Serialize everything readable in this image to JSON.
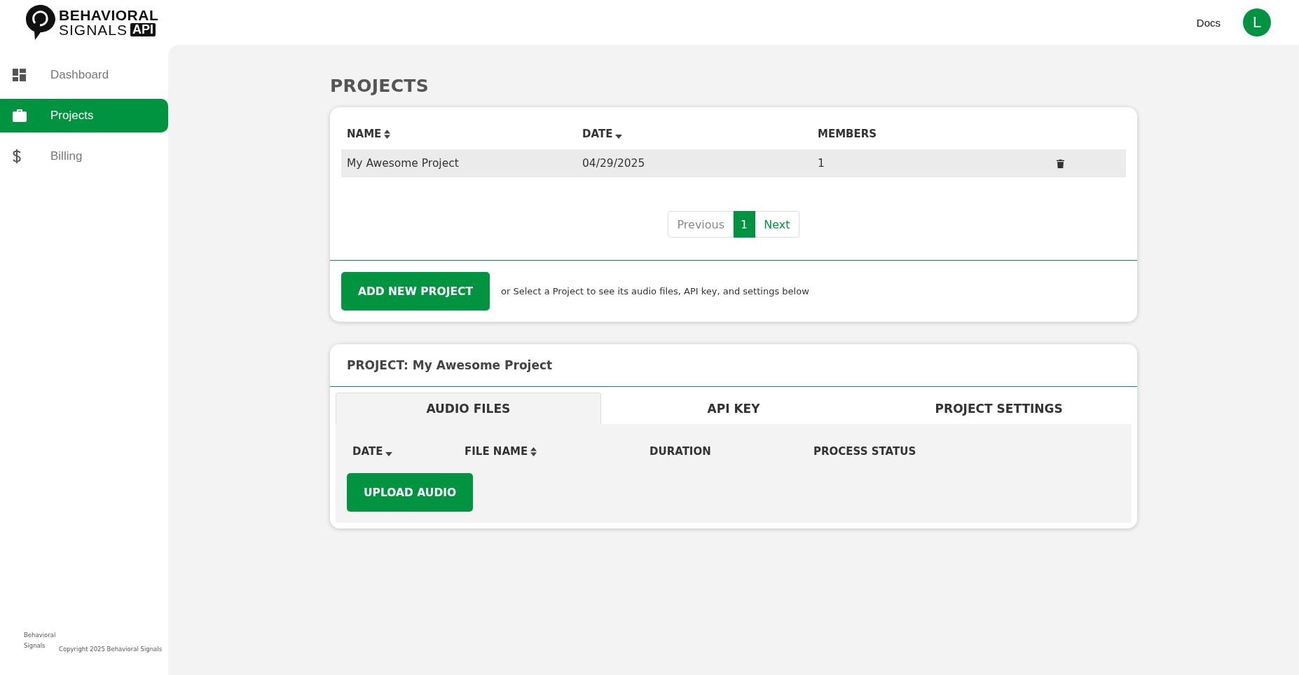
{
  "header": {
    "logo": {
      "line_1": "BEHAVIORAL",
      "line_2": "SIGNALS",
      "badge": "API"
    },
    "docs_link": "Docs",
    "avatar_initial": "L"
  },
  "sidebar": {
    "items": [
      {
        "label": "Dashboard",
        "kind": "dashboard",
        "selected": false
      },
      {
        "label": "Projects",
        "kind": "briefcase",
        "selected": true
      },
      {
        "label": "Billing",
        "kind": "dollar",
        "selected": false
      }
    ],
    "footer": {
      "logo_alt": "Behavioral Signals",
      "copyright": "Copyright 2025 Behavioral Signals"
    }
  },
  "page_title": "PROJECTS",
  "projects_table": {
    "columns": [
      {
        "label": "NAME",
        "kind": "sortable"
      },
      {
        "label": "DATE",
        "kind": "sorted"
      },
      {
        "label": "MEMBERS",
        "kind": "plain"
      }
    ],
    "rows": [
      {
        "name": "My Awesome Project",
        "date": "04/29/2025",
        "members": "1",
        "selected": true
      }
    ]
  },
  "pagination": {
    "previous": "Previous",
    "previous_disabled": true,
    "pages": [
      {
        "label": "1",
        "selected": true
      }
    ],
    "next": "Next",
    "next_disabled": false
  },
  "add_project_button": "ADD NEW PROJECT",
  "add_project_hint": "or Select a Project to see its audio files, API key, and settings below",
  "project_panel": {
    "title": "PROJECT: My Awesome Project",
    "tabs": [
      {
        "label": "AUDIO FILES",
        "selected": true
      },
      {
        "label": "API KEY",
        "selected": false
      },
      {
        "label": "PROJECT SETTINGS",
        "selected": false
      }
    ],
    "files_table": {
      "columns": [
        {
          "label": "DATE",
          "kind": "sorted"
        },
        {
          "label": "FILE NAME",
          "kind": "sortable"
        },
        {
          "label": "DURATION",
          "kind": "plain"
        },
        {
          "label": "PROCESS STATUS",
          "kind": "plain"
        }
      ]
    },
    "upload_button": "UPLOAD AUDIO"
  }
}
